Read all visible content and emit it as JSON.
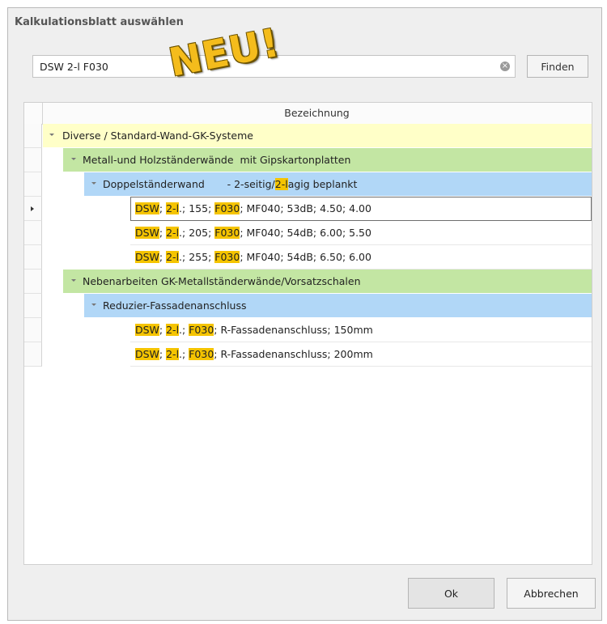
{
  "dialog": {
    "title": "Kalkulationsblatt auswählen",
    "badge": "NEU!"
  },
  "search": {
    "value": "DSW 2-l F030",
    "find_label": "Finden"
  },
  "grid": {
    "column_header": "Bezeichnung",
    "group1": {
      "label": "Diverse / Standard-Wand-GK-Systeme",
      "sub1": {
        "label": "Metall-und Holzständerwände  mit Gipskartonplatten",
        "sub": {
          "label_a": "Doppelständerwand       - 2-seitig/",
          "label_hl": "2-l",
          "label_b": "agig beplankt"
        },
        "rows": [
          {
            "t1": "DSW",
            "t2": "; ",
            "t3": "2-l",
            "t4": ".; 155; ",
            "t5": "F030",
            "t6": "; MF040; 53dB; 4.50; 4.00"
          },
          {
            "t1": "DSW",
            "t2": "; ",
            "t3": "2-l",
            "t4": ".; 205; ",
            "t5": "F030",
            "t6": "; MF040; 54dB; 6.00; 5.50"
          },
          {
            "t1": "DSW",
            "t2": "; ",
            "t3": "2-l",
            "t4": ".; 255; ",
            "t5": "F030",
            "t6": "; MF040; 54dB; 6.50; 6.00"
          }
        ]
      },
      "sub2": {
        "label": "Nebenarbeiten GK-Metallständerwände/Vorsatzschalen",
        "sub": {
          "label": "Reduzier-Fassadenanschluss"
        },
        "rows": [
          {
            "t1": "DSW",
            "t2": "; ",
            "t3": "2-l",
            "t4": ".; ",
            "t5": "F030",
            "t6": "; R-Fassadenanschluss; 150mm"
          },
          {
            "t1": "DSW",
            "t2": "; ",
            "t3": "2-l",
            "t4": ".; ",
            "t5": "F030",
            "t6": "; R-Fassadenanschluss; 200mm"
          }
        ]
      }
    }
  },
  "buttons": {
    "ok": "Ok",
    "cancel": "Abbrechen"
  },
  "colors": {
    "level0": "#ffffc8",
    "level1": "#c3e6a3",
    "level2": "#b1d7f7",
    "highlight": "#f5c400"
  }
}
